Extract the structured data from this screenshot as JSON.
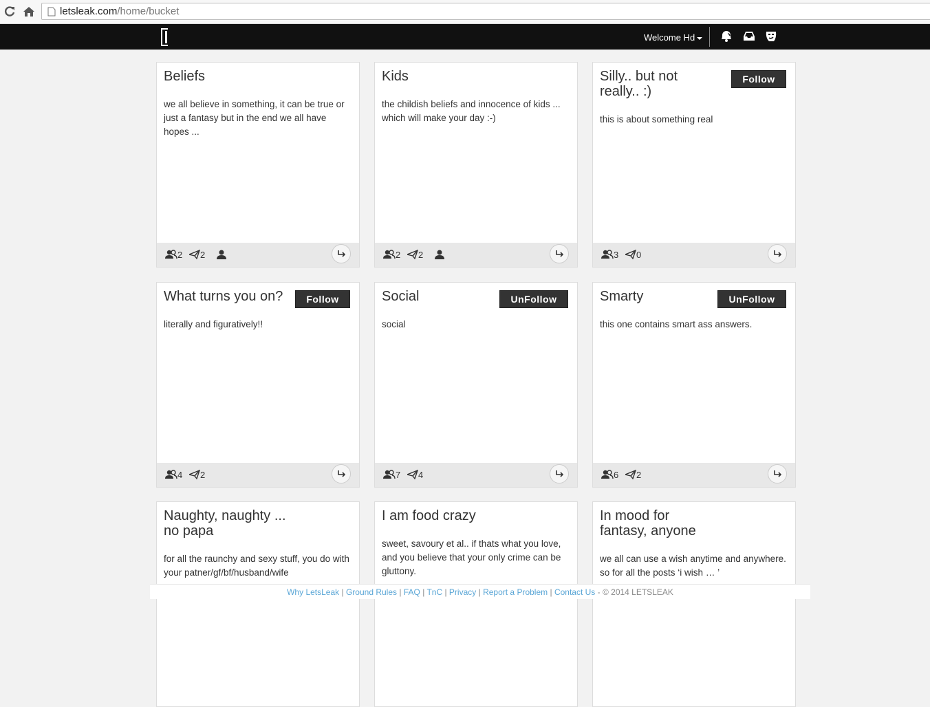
{
  "browser": {
    "url_host": "letsleak.com",
    "url_path": "/home/bucket"
  },
  "navbar": {
    "welcome_label": "Welcome Hd"
  },
  "cards": [
    {
      "title": "Beliefs",
      "description": "we all believe in something, it can be true or just a fantasy but in the end we all have hopes ...",
      "members": "2",
      "posts": "2",
      "button": ""
    },
    {
      "title": "Kids",
      "description": "the childish beliefs and innocence of kids ... which will make your day :-)",
      "members": "2",
      "posts": "2",
      "button": ""
    },
    {
      "title": "Silly.. but not really.. :)",
      "description": "this is about something real",
      "members": "3",
      "posts": "0",
      "button": "Follow"
    },
    {
      "title": "What turns you on?",
      "description": "literally and figuratively!!",
      "members": "4",
      "posts": "2",
      "button": "Follow"
    },
    {
      "title": "Social",
      "description": "social",
      "members": "7",
      "posts": "4",
      "button": "UnFollow"
    },
    {
      "title": "Smarty",
      "description": "this one contains smart ass answers.",
      "members": "6",
      "posts": "2",
      "button": "UnFollow"
    },
    {
      "title": "Naughty, naughty ... no papa",
      "description": "for all the raunchy and sexy stuff, you do with your patner/gf/bf/husband/wife",
      "button": ""
    },
    {
      "title": "I am food crazy",
      "description": "sweet, savoury et al.. if thats what you love, and you believe that your only crime can be gluttony.",
      "button": ""
    },
    {
      "title": "In mood for fantasy, anyone",
      "description": "we all can use a wish anytime and anywhere. so for all the posts ‘i wish … ’",
      "button": ""
    }
  ],
  "footer": {
    "links": [
      "Why LetsLeak",
      "Ground Rules",
      "FAQ",
      "TnC",
      "Privacy",
      "Report a Problem",
      "Contact Us"
    ],
    "separator": "|",
    "copyright": "- © 2014 LETSLEAK"
  }
}
